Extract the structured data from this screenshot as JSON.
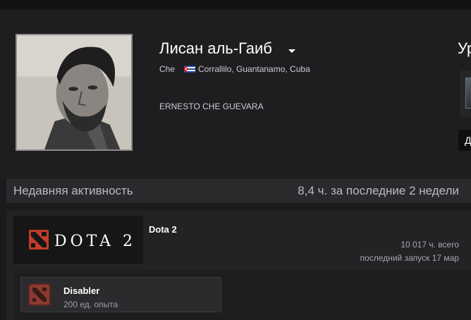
{
  "profile": {
    "persona_name": "Лисан аль-Гаиб",
    "real_name": "Che",
    "location": "Corrallilo, Guantanamo, Cuba",
    "summary": "ERNESTO CHE GUEVARA",
    "level_label": "Ур",
    "side_button_label": "Д"
  },
  "recent_activity": {
    "title": "Недавняя активность",
    "hours_value": "8,4",
    "hours_text": "ч. за последние",
    "weeks_value": "2",
    "weeks_text": "недели"
  },
  "game": {
    "logo_text": "DOTA 2",
    "name": "Dota 2",
    "total_hours": "10 017 ч. всего",
    "last_played": "последний запуск 17 мар",
    "achievement": {
      "title": "Disabler",
      "xp": "200 ед. опыта"
    }
  },
  "colors": {
    "page_background": "#1b1b1d",
    "panel_background": "#2a2a2d",
    "accent_dota_red": "#c23c2a",
    "flag_blue": "#1f4aa8",
    "flag_red": "#d21f1f"
  },
  "icons": {
    "dropdown": "chevron-down-icon",
    "flag": "cuba-flag-icon",
    "game_logo": "dota2-logo-icon",
    "achievement": "dota2-achievement-icon"
  }
}
